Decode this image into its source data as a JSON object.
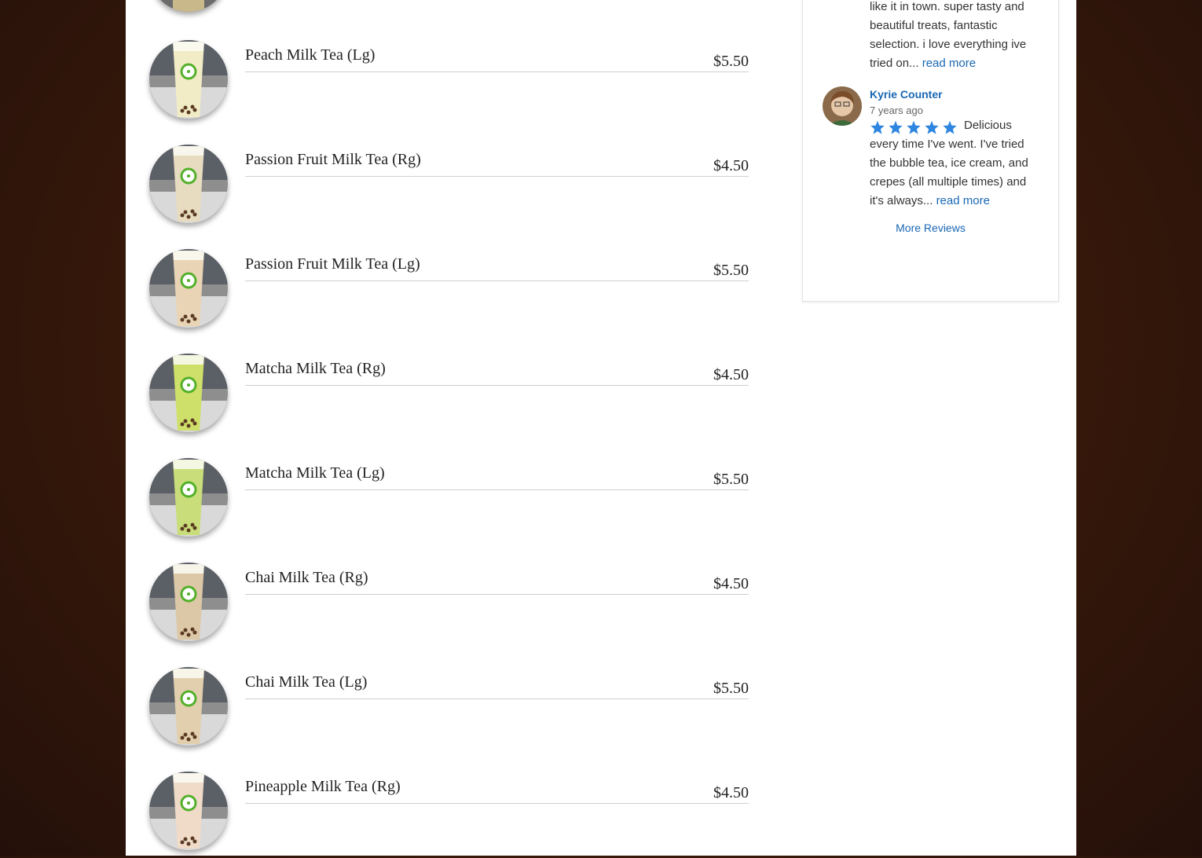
{
  "menu": {
    "items": [
      {
        "name": "Peach Milk Tea (Lg)",
        "price": "$5.50",
        "tea_color": "#f2ecc6"
      },
      {
        "name": "Passion Fruit Milk Tea (Rg)",
        "price": "$4.50",
        "tea_color": "#e7dcc0"
      },
      {
        "name": "Passion Fruit Milk Tea (Lg)",
        "price": "$5.50",
        "tea_color": "#e9d5b6"
      },
      {
        "name": "Matcha Milk Tea (Rg)",
        "price": "$4.50",
        "tea_color": "#cfe06a"
      },
      {
        "name": "Matcha Milk Tea (Lg)",
        "price": "$5.50",
        "tea_color": "#c9de7a"
      },
      {
        "name": "Chai Milk Tea (Rg)",
        "price": "$4.50",
        "tea_color": "#dcc7a6"
      },
      {
        "name": "Chai Milk Tea (Lg)",
        "price": "$5.50",
        "tea_color": "#e2cfae"
      },
      {
        "name": "Pineapple Milk Tea (Rg)",
        "price": "$4.50",
        "tea_color": "#f0dbc9"
      }
    ]
  },
  "reviews": {
    "prev_review_text": "like it in town.   super tasty and beautiful treats, fantastic selection.  i love everything ive tried on...",
    "prev_read_more": "read more",
    "review": {
      "author": "Kyrie Counter",
      "date": "7 years ago",
      "rating": 5,
      "text": "Delicious every time I've went. I've tried the bubble tea, ice cream, and crepes (all multiple times) and it's always...",
      "read_more": "read more"
    },
    "more_reviews_label": "More Reviews"
  },
  "colors": {
    "link": "#1a67b3",
    "star": "#2f86e0",
    "background": "#3a1a0a"
  }
}
